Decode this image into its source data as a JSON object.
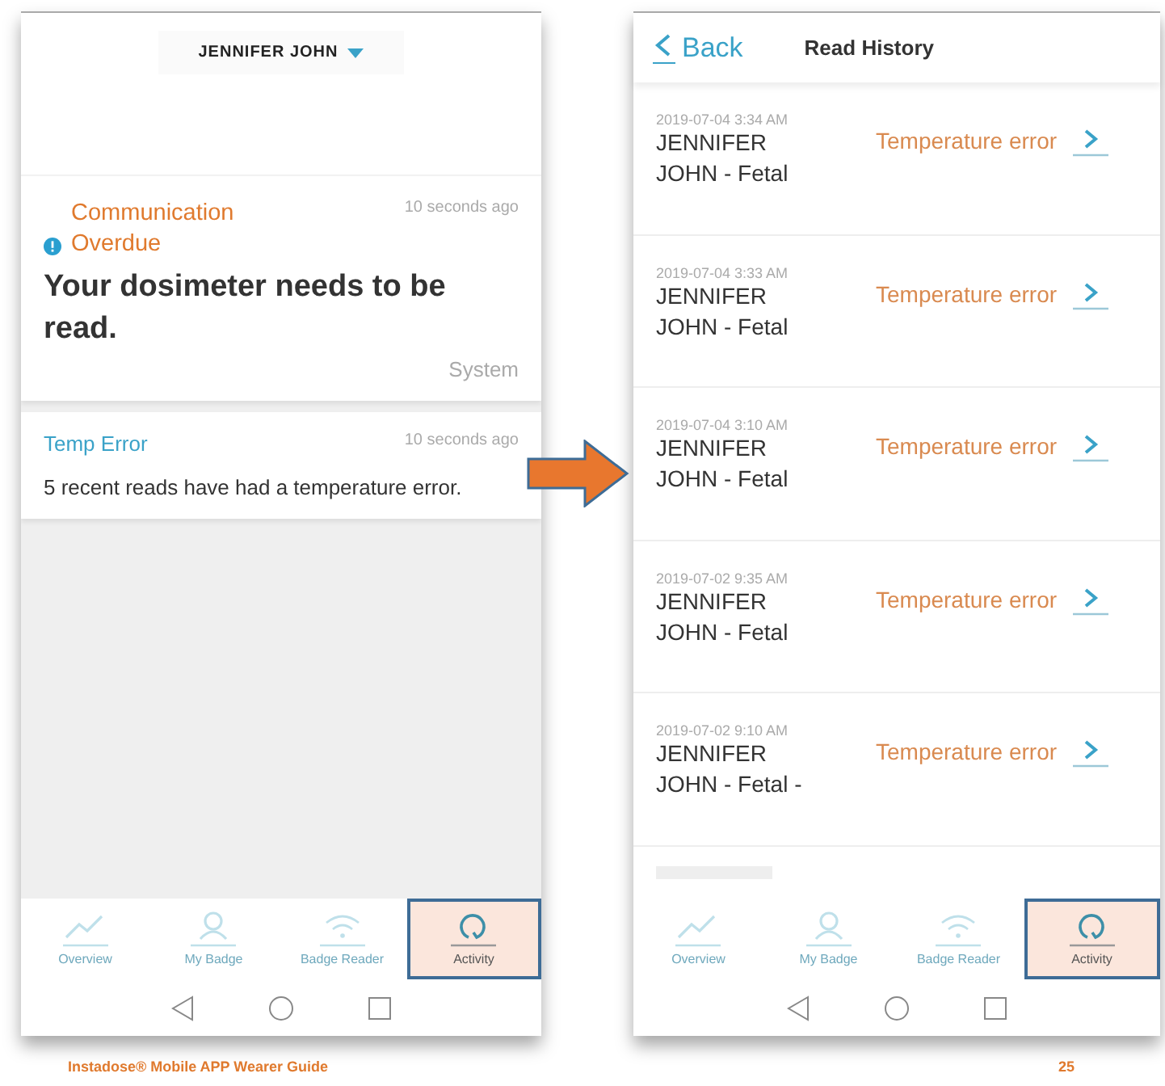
{
  "left_screen": {
    "profile_selector": {
      "label": "JENNIFER JOHN",
      "expanded": false
    },
    "notifications": [
      {
        "kind": "alert",
        "title": "Communication Overdue",
        "time": "10 seconds ago",
        "message": "Your dosimeter needs to be read.",
        "source": "System"
      },
      {
        "kind": "info",
        "title": "Temp Error",
        "time": "10 seconds ago",
        "message": "5 recent reads have had a temperature error."
      }
    ],
    "tab_bar": [
      {
        "label": "Overview",
        "selected": false
      },
      {
        "label": "My Badge",
        "selected": false
      },
      {
        "label": "Badge Reader",
        "selected": false
      },
      {
        "label": "Activity",
        "selected": true
      }
    ]
  },
  "right_screen": {
    "back": "Back",
    "title": "Read History",
    "reads": [
      {
        "timestamp": "2019-07-04 3:34 AM",
        "name": "JENNIFER JOHN - Fetal",
        "status": "Temperature error"
      },
      {
        "timestamp": "2019-07-04 3:33 AM",
        "name": "JENNIFER JOHN - Fetal",
        "status": "Temperature error"
      },
      {
        "timestamp": "2019-07-04 3:10 AM",
        "name": "JENNIFER JOHN - Fetal",
        "status": "Temperature error"
      },
      {
        "timestamp": "2019-07-02 9:35 AM",
        "name": "JENNIFER JOHN - Fetal",
        "status": "Temperature error"
      },
      {
        "timestamp": "2019-07-02 9:10 AM",
        "name": "JENNIFER JOHN - Fetal  -",
        "status": "Temperature error"
      }
    ],
    "tab_bar": [
      {
        "label": "Overview",
        "selected": false
      },
      {
        "label": "My Badge",
        "selected": false
      },
      {
        "label": "Badge Reader",
        "selected": false
      },
      {
        "label": "Activity",
        "selected": true
      }
    ]
  },
  "footer": {
    "guide_title": "Instadose® Mobile APP Wearer Guide",
    "page_number": "25"
  }
}
